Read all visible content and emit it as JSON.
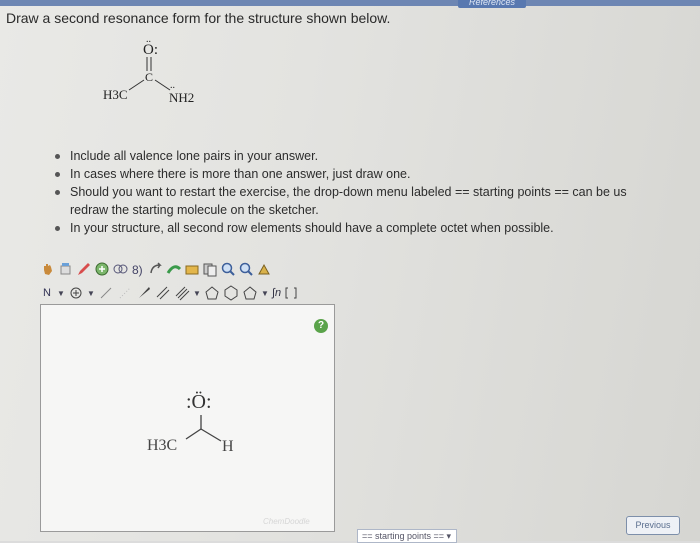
{
  "header": {
    "references_label": "References"
  },
  "question": {
    "prompt": "Draw a second resonance form for the structure shown below."
  },
  "structure": {
    "o_label": "O:",
    "c_label": "C",
    "h3c_label": "H3C",
    "nh2_label": "NH2"
  },
  "instructions": [
    {
      "text": "Include all valence lone pairs in your answer."
    },
    {
      "text": "In cases where there is more than one answer, just draw one."
    },
    {
      "text": "Should you want to restart the exercise, the drop-down menu labeled == starting points == can be us",
      "continuation": "redraw the starting molecule on the sketcher."
    },
    {
      "text": "In your structure, all second row elements should have a complete octet when possible."
    }
  ],
  "sketcher": {
    "toolbar_row1_icons": [
      "hand-tool-icon",
      "eraser-icon",
      "pencil-icon",
      "clean-icon",
      "ring-icon",
      "bracket-icon",
      "arrow-icon",
      "flip-icon",
      "template-icon",
      "copy-icon",
      "zoom-in-icon",
      "zoom-out-icon",
      "settings-icon"
    ],
    "element_label": "N",
    "sn_label": "∫n",
    "help_label": "?",
    "watermark": "ChemDoodle",
    "canvas_molecule": {
      "o_label": ":Ö:",
      "h3c_label": "H3C",
      "h_label": "H"
    }
  },
  "footer": {
    "dropdown_value": "== starting points == ▾",
    "previous_label": "Previous"
  },
  "colors": {
    "top_band": "#6d86b3",
    "help_green": "#5aa34a",
    "canvas_bg": "#f6f6f5"
  }
}
